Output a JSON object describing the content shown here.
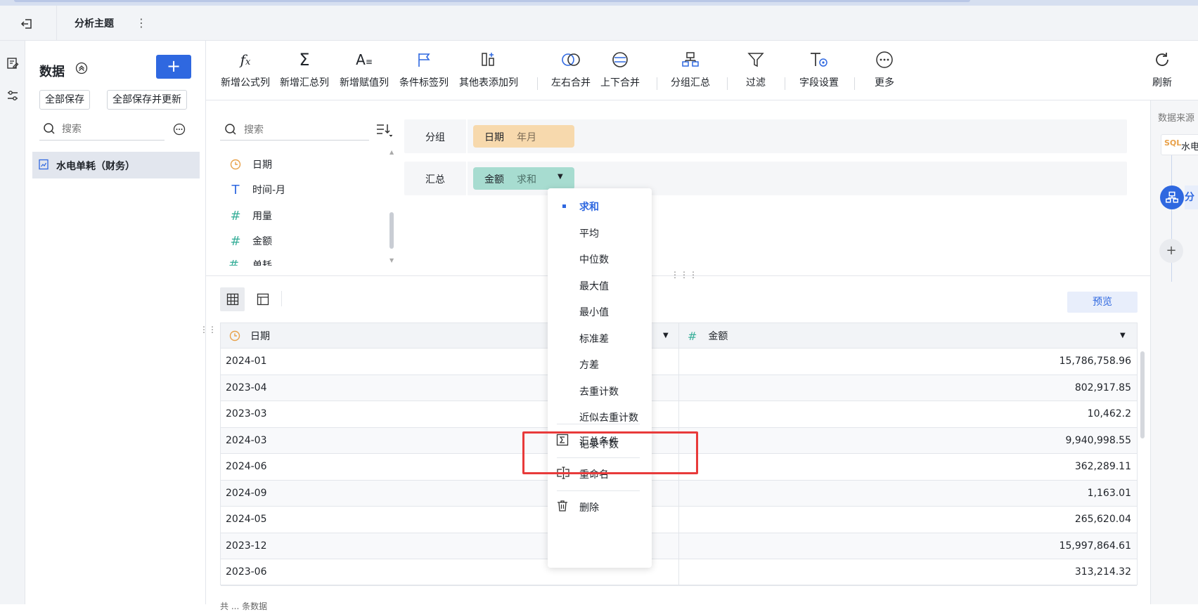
{
  "header": {
    "title": "分析主题"
  },
  "data_panel": {
    "title": "数据",
    "save_all": "全部保存",
    "save_all_update": "全部保存并更新",
    "search_placeholder": "搜索",
    "table_name": "水电单耗（财务）"
  },
  "toolbar": {
    "items": [
      {
        "label": "新增公式列",
        "icon": "formula-icon"
      },
      {
        "label": "新增汇总列",
        "icon": "sigma-icon"
      },
      {
        "label": "新增赋值列",
        "icon": "assign-icon"
      },
      {
        "label": "条件标签列",
        "icon": "flag-icon"
      },
      {
        "label": "其他表添加列",
        "icon": "add-column-icon"
      },
      {
        "label": "左右合并",
        "icon": "merge-horizontal-icon"
      },
      {
        "label": "上下合并",
        "icon": "merge-vertical-icon"
      },
      {
        "label": "分组汇总",
        "icon": "group-summary-icon"
      },
      {
        "label": "过滤",
        "icon": "filter-icon"
      },
      {
        "label": "字段设置",
        "icon": "field-settings-icon"
      },
      {
        "label": "更多",
        "icon": "more-icon"
      }
    ],
    "refresh": "刷新"
  },
  "fields": {
    "search_placeholder": "搜索",
    "items": [
      {
        "name": "日期",
        "type": "date"
      },
      {
        "name": "时间-月",
        "type": "text"
      },
      {
        "name": "用量",
        "type": "number"
      },
      {
        "name": "金额",
        "type": "number"
      },
      {
        "name": "单耗",
        "type": "number"
      }
    ]
  },
  "config": {
    "group_label": "分组",
    "group_field": "日期",
    "group_sub": "年月",
    "sum_label": "汇总",
    "sum_field": "金额",
    "sum_sub": "求和"
  },
  "preview": "预览",
  "grid": {
    "columns": [
      "日期",
      "金额"
    ],
    "rows": [
      [
        "2024-01",
        "15,786,758.96"
      ],
      [
        "2023-04",
        "802,917.85"
      ],
      [
        "2023-03",
        "10,462.2"
      ],
      [
        "2024-03",
        "9,940,998.55"
      ],
      [
        "2024-06",
        "362,289.11"
      ],
      [
        "2024-09",
        "1,163.01"
      ],
      [
        "2024-05",
        "265,620.04"
      ],
      [
        "2023-12",
        "15,997,864.61"
      ],
      [
        "2023-06",
        "313,214.32"
      ]
    ],
    "footer": "共 ... 条数据"
  },
  "menu": {
    "aggregations": [
      "求和",
      "平均",
      "中位数",
      "最大值",
      "最小值",
      "标准差",
      "方差",
      "去重计数",
      "近似去重计数",
      "记录个数"
    ],
    "selected": "求和",
    "actions": [
      "汇总条件",
      "重命名",
      "删除"
    ]
  },
  "right_panel": {
    "title": "数据来源",
    "source": "水电",
    "node_label": "分"
  },
  "colors": {
    "accent": "#2f68e0",
    "highlight": "#e83a3a",
    "group_chip": "#f7d9ad",
    "sum_chip": "#a7dcd0"
  }
}
